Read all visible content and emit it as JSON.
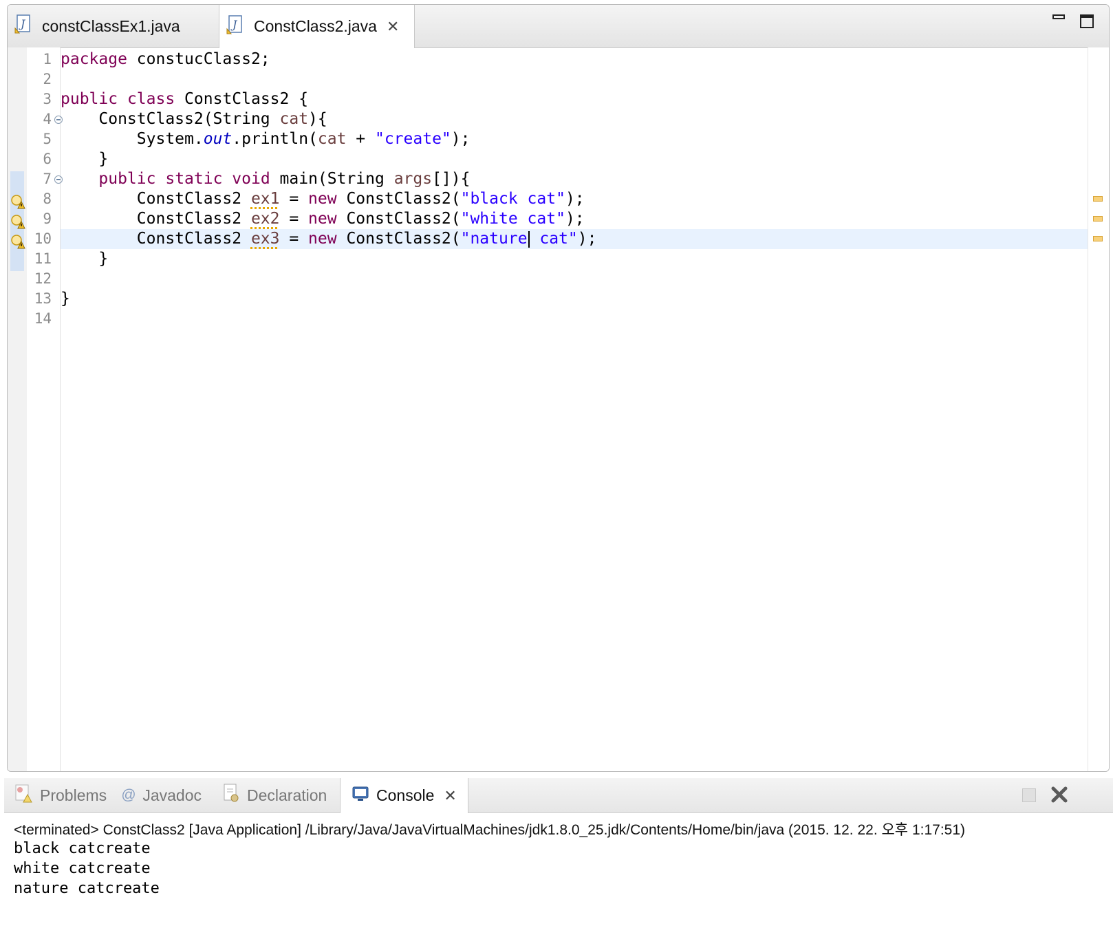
{
  "editor": {
    "tabs": [
      {
        "label": "constClassEx1.java",
        "active": false
      },
      {
        "label": "ConstClass2.java",
        "active": true,
        "close": "✕"
      }
    ],
    "line_numbers": [
      "1",
      "2",
      "3",
      "4",
      "5",
      "6",
      "7",
      "8",
      "9",
      "10",
      "11",
      "12",
      "13",
      "14"
    ],
    "code": {
      "l1": {
        "kw": "package",
        "rest": " constucClass2;"
      },
      "l3": {
        "kw1": "public",
        "kw2": "class",
        "rest": " ConstClass2 {"
      },
      "l4": {
        "name": "    ConstClass2(String ",
        "param": "cat",
        "rest": "){"
      },
      "l5": {
        "a": "        System.",
        "field": "out",
        "b": ".println(",
        "param": "cat",
        "c": " + ",
        "str": "\"create\"",
        "d": ");"
      },
      "l6": {
        "text": "    }"
      },
      "l7": {
        "indent": "    ",
        "kw1": "public",
        "kw2": "static",
        "kw3": "void",
        "a": " main(String ",
        "param": "args",
        "b": "[]){"
      },
      "l8": {
        "a": "        ConstClass2 ",
        "var": "ex1",
        "b": " = ",
        "kw": "new",
        "c": " ConstClass2(",
        "str": "\"black cat\"",
        "d": ");"
      },
      "l9": {
        "a": "        ConstClass2 ",
        "var": "ex2",
        "b": " = ",
        "kw": "new",
        "c": " ConstClass2(",
        "str": "\"white cat\"",
        "d": ");"
      },
      "l10": {
        "a": "        ConstClass2 ",
        "var": "ex3",
        "b": " = ",
        "kw": "new",
        "c": " ConstClass2(",
        "str1": "\"nature",
        "str2": " cat\"",
        "d": ");"
      },
      "l11": {
        "text": "    }"
      },
      "l13": {
        "text": "}"
      }
    }
  },
  "console_panel": {
    "tabs": [
      {
        "label": "Problems",
        "active": false
      },
      {
        "label": "Javadoc",
        "active": false
      },
      {
        "label": "Declaration",
        "active": false
      },
      {
        "label": "Console",
        "active": true,
        "close": "✕"
      }
    ],
    "header": "<terminated> ConstClass2 [Java Application] /Library/Java/JavaVirtualMachines/jdk1.8.0_25.jdk/Contents/Home/bin/java (2015. 12. 22. 오후 1:17:51)",
    "output": [
      "black catcreate",
      "white catcreate",
      "nature catcreate"
    ]
  },
  "icons": {
    "java_file": "java-file-icon",
    "warning": "warning-icon",
    "problems": "problems-icon",
    "javadoc": "at-icon",
    "declaration": "declaration-icon",
    "console": "console-monitor-icon",
    "terminate": "terminate-icon",
    "remove_launch": "remove-launch-icon"
  },
  "colors": {
    "keyword": "#7f0055",
    "string": "#2a00ff",
    "field": "#0000c0",
    "local": "#6a3e3e",
    "warning": "#e8a800",
    "current_line": "#e8f2fe"
  }
}
